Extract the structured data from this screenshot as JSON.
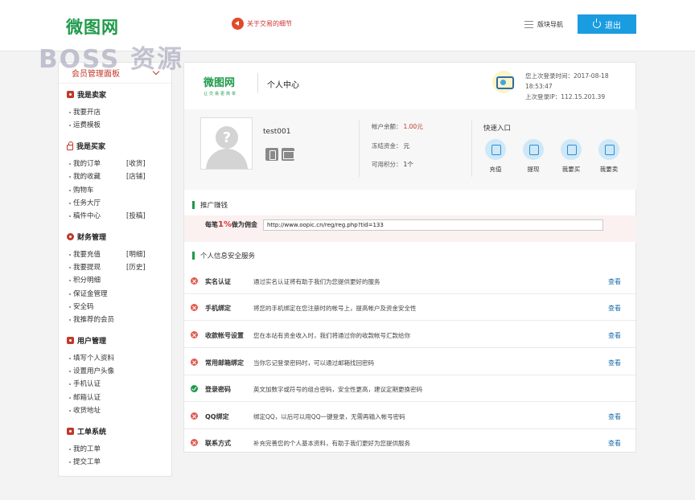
{
  "header": {
    "logo": "微图网",
    "watermark": "BOSS 资源",
    "notice": "关于交易的细节",
    "nav_label": "版块导航",
    "logout_label": "退出"
  },
  "sidebar": {
    "panel_title": "会员管理面板",
    "groups": [
      {
        "title": "我是卖家",
        "icon": "shop-icon",
        "items": [
          {
            "label": "我要开店",
            "tag": ""
          },
          {
            "label": "运费模板",
            "tag": ""
          }
        ]
      },
      {
        "title": "我是买家",
        "icon": "lock-icon",
        "items": [
          {
            "label": "我的订单",
            "tag": "[收货]"
          },
          {
            "label": "我的收藏",
            "tag": "[店铺]"
          },
          {
            "label": "购物车",
            "tag": ""
          },
          {
            "label": "任务大厅",
            "tag": ""
          },
          {
            "label": "稿件中心",
            "tag": "[投稿]"
          }
        ]
      },
      {
        "title": "财务管理",
        "icon": "finance-icon",
        "items": [
          {
            "label": "我要充值",
            "tag": "[明细]"
          },
          {
            "label": "我要提现",
            "tag": "[历史]"
          },
          {
            "label": "积分明细",
            "tag": ""
          },
          {
            "label": "保证金管理",
            "tag": ""
          },
          {
            "label": "安全码",
            "tag": ""
          },
          {
            "label": "我推荐的会员",
            "tag": ""
          }
        ]
      },
      {
        "title": "用户管理",
        "icon": "user-icon",
        "items": [
          {
            "label": "填写个人资料",
            "tag": ""
          },
          {
            "label": "设置用户头像",
            "tag": ""
          },
          {
            "label": "手机认证",
            "tag": ""
          },
          {
            "label": "邮箱认证",
            "tag": ""
          },
          {
            "label": "收货地址",
            "tag": ""
          }
        ]
      },
      {
        "title": "工单系统",
        "icon": "ticket-icon",
        "items": [
          {
            "label": "我的工单",
            "tag": ""
          },
          {
            "label": "提交工单",
            "tag": ""
          }
        ]
      }
    ]
  },
  "main": {
    "logo": "微图网",
    "logo_slogan": "让交易更简单",
    "title": "个人中心",
    "last_login_time": "您上次登录时间：2017-08-18 18:53:47",
    "last_login_ip": "上次登录IP：112.15.201.39",
    "username": "test001",
    "balance_label": "帐户余额：",
    "balance_value": "1.00元",
    "frozen_label": "冻结资金：",
    "frozen_value": "元",
    "points_label": "可用积分：",
    "points_value": "1个",
    "quick_title": "快速入口",
    "quick_items": [
      "充值",
      "提现",
      "我要买",
      "我要卖"
    ],
    "promo_section": "推广赚钱",
    "promo_label_pre": "每笔",
    "promo_pct": "1%",
    "promo_label_post": "做为佣金",
    "promo_url": "http://www.oopic.cn/reg/reg.php?tid=133",
    "security_section": "个人信息安全服务",
    "view_label": "查看",
    "security_rows": [
      {
        "name": "实名认证",
        "desc": "通过实名认证将有助于我们为您提供更好的服务",
        "ok": false
      },
      {
        "name": "手机绑定",
        "desc": "将您的手机绑定在您注册时的帐号上，提高帐户及资金安全性",
        "ok": false
      },
      {
        "name": "收款帐号设置",
        "desc": "您在本站有资金收入时，我们将通过你的收款帐号汇款给你",
        "ok": false
      },
      {
        "name": "常用邮箱绑定",
        "desc": "当你忘记登录密码时，可以通过邮箱找回密码",
        "ok": false
      },
      {
        "name": "登录密码",
        "desc": "英文加数字或符号的组合密码，安全性更高，建议定期更换密码",
        "ok": true
      },
      {
        "name": "QQ绑定",
        "desc": "绑定QQ，以后可以用QQ一键登录，无需再输入帐号密码",
        "ok": false
      },
      {
        "name": "联系方式",
        "desc": "补充完善您的个人基本资料，有助于我们更好为您提供服务",
        "ok": false
      }
    ]
  },
  "colors": {
    "brand_green": "#1e9a4a",
    "accent_blue": "#1a9ce0",
    "alert_red": "#c0392b"
  }
}
